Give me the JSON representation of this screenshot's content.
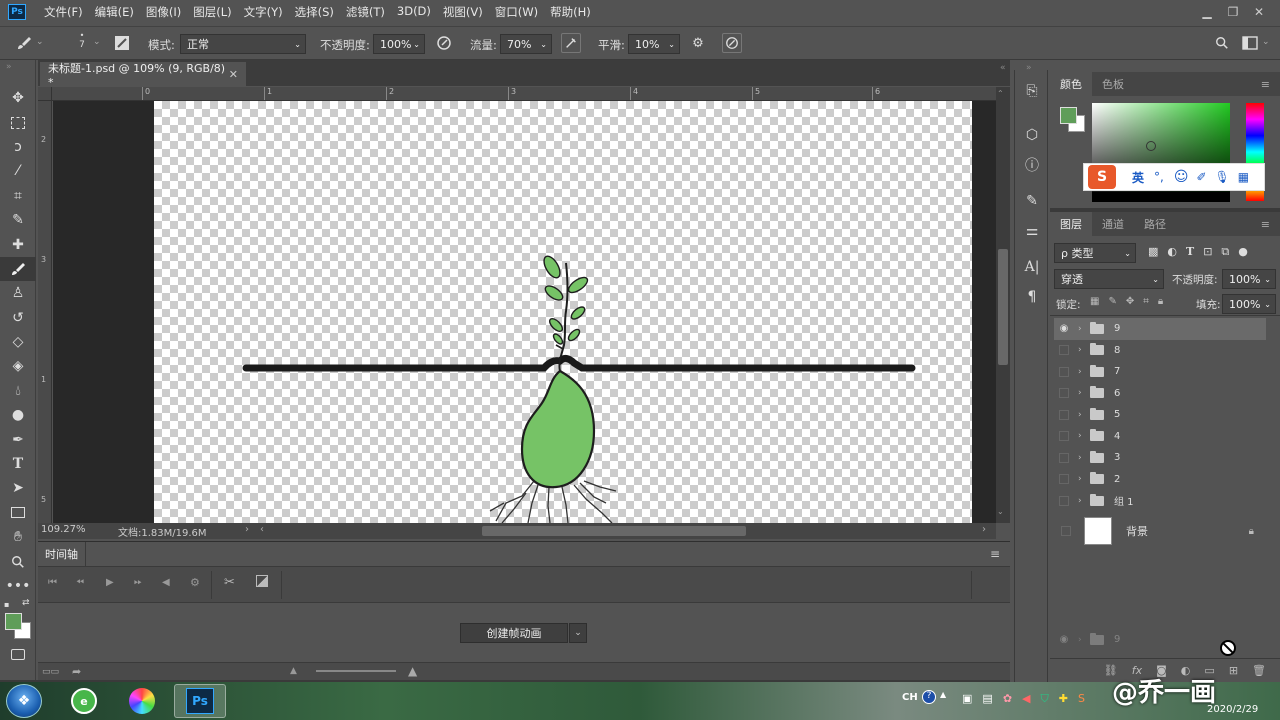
{
  "app": {
    "logo": "Ps"
  },
  "menu": [
    "文件(F)",
    "编辑(E)",
    "图像(I)",
    "图层(L)",
    "文字(Y)",
    "选择(S)",
    "滤镜(T)",
    "3D(D)",
    "视图(V)",
    "窗口(W)",
    "帮助(H)"
  ],
  "options": {
    "brush_size": "7",
    "mode_label": "模式:",
    "mode_value": "正常",
    "opacity_label": "不透明度:",
    "opacity_value": "100%",
    "flow_label": "流量:",
    "flow_value": "70%",
    "smooth_label": "平滑:",
    "smooth_value": "10%"
  },
  "document": {
    "tab_title": "未标题-1.psd @ 109% (9, RGB/8) *",
    "zoom": "109.27%",
    "doc_info": "文档:1.83M/19.6M",
    "ruler_top": [
      "0",
      "1",
      "2",
      "3",
      "4",
      "5",
      "6"
    ],
    "ruler_left": [
      "2",
      "3",
      "1",
      "5"
    ]
  },
  "timeline": {
    "tab": "时间轴",
    "create_button": "创建帧动画"
  },
  "color_panel": {
    "tabs": [
      "颜色",
      "色板"
    ],
    "foreground": "#5f9d59",
    "background": "#ffffff"
  },
  "ime": {
    "lang": "英"
  },
  "layers_panel": {
    "tabs": [
      "图层",
      "通道",
      "路径"
    ],
    "filter_label": "类型",
    "blend_mode": "穿透",
    "opacity_label": "不透明度:",
    "opacity_value": "100%",
    "lock_label": "锁定:",
    "fill_label": "填充:",
    "fill_value": "100%",
    "layers": [
      {
        "name": "9",
        "visible": true,
        "selected": true
      },
      {
        "name": "8",
        "visible": false
      },
      {
        "name": "7",
        "visible": false
      },
      {
        "name": "6",
        "visible": false
      },
      {
        "name": "5",
        "visible": false
      },
      {
        "name": "4",
        "visible": false
      },
      {
        "name": "3",
        "visible": false
      },
      {
        "name": "2",
        "visible": false
      },
      {
        "name": "组 1",
        "visible": false
      }
    ],
    "background_layer": "背景",
    "drag_ghost": "9"
  },
  "taskbar": {
    "lang": "CH",
    "date": "2020/2/29",
    "watermark": "@乔一画"
  }
}
